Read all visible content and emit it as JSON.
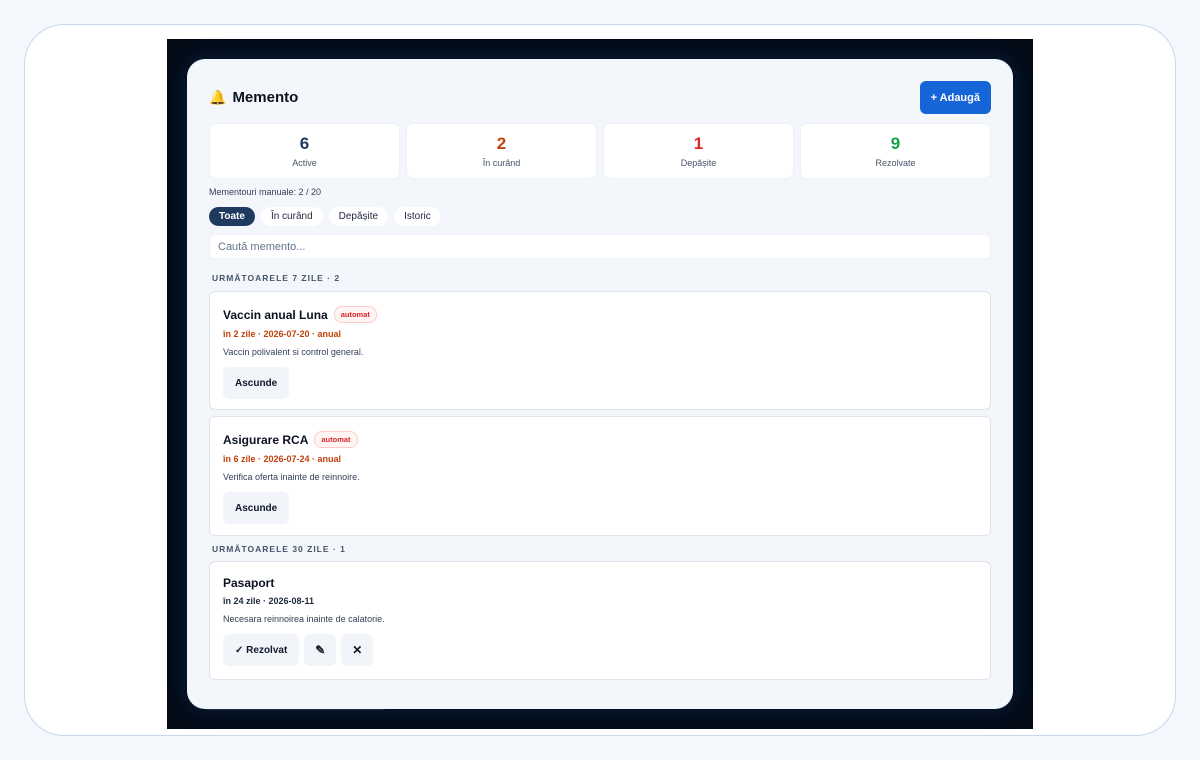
{
  "app": {
    "title": "Memento",
    "bell_icon": "🔔",
    "add_label": "+ Adaugă"
  },
  "stats": [
    {
      "value": "6",
      "label": "Active",
      "color": "#1e3a5f"
    },
    {
      "value": "2",
      "label": "În curând",
      "color": "#c2410c"
    },
    {
      "value": "1",
      "label": "Depășite",
      "color": "#dc2626"
    },
    {
      "value": "9",
      "label": "Rezolvate",
      "color": "#16a34a"
    }
  ],
  "manual_count": "Mementouri manuale: 2 / 20",
  "filters": [
    "Toate",
    "În curând",
    "Depășite",
    "Istoric"
  ],
  "active_filter": "Toate",
  "search": {
    "placeholder": "Caută memento..."
  },
  "sections": [
    {
      "title": "URMĂTOARELE 7 ZILE · 2",
      "items": [
        {
          "title": "Vaccin anual Luna",
          "badge": "automat",
          "meta": "în 2 zile · 2026-07-20 · anual",
          "description": "Vaccin polivalent si control general.",
          "action": "Ascunde"
        },
        {
          "title": "Asigurare RCA",
          "badge": "automat",
          "meta": "în 6 zile · 2026-07-24 · anual",
          "description": "Verifica oferta inainte de reinnoire.",
          "action": "Ascunde"
        }
      ]
    },
    {
      "title": "URMĂTOARELE 30 ZILE · 1",
      "items": [
        {
          "title": "Pasaport",
          "meta": "în 24 zile · 2026-08-11",
          "description": "Necesara reinnoirea inainte de calatorie.",
          "resolve_label": "✓ Rezolvat",
          "edit_icon": "✎",
          "delete_icon": "✕"
        }
      ]
    }
  ]
}
